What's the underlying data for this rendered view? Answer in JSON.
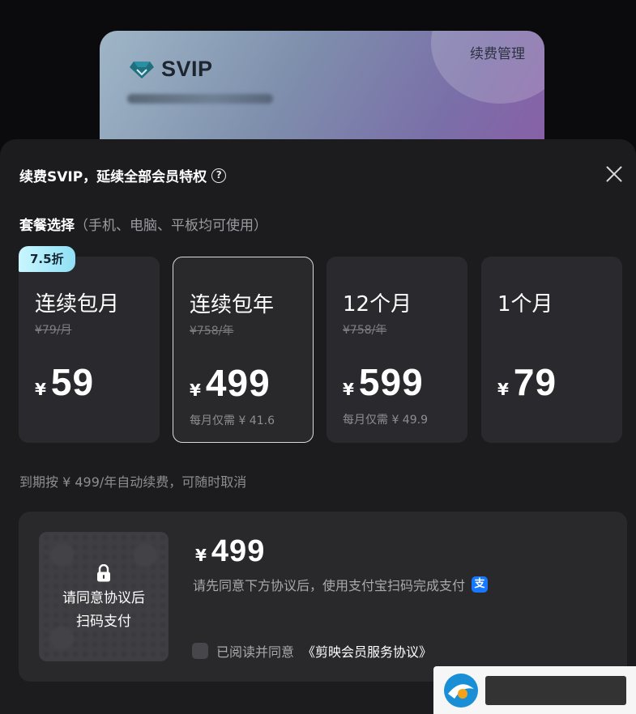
{
  "svip_card": {
    "title": "SVIP",
    "manage_label": "续费管理",
    "brand_color": "#1c2530"
  },
  "modal": {
    "title": "续费SVIP，延续全部会员特权",
    "help_icon": "?",
    "section_label": "套餐选择",
    "section_sub": "（手机、电脑、平板均可使用）",
    "plans": [
      {
        "name": "连续包月",
        "original_price": "¥79/月",
        "currency": "¥",
        "price": "59",
        "monthly": "",
        "badge": "7.5折",
        "selected": false
      },
      {
        "name": "连续包年",
        "original_price": "¥758/年",
        "currency": "¥",
        "price": "499",
        "monthly": "每月仅需 ¥ 41.6",
        "badge": "",
        "selected": true
      },
      {
        "name": "12个月",
        "original_price": "¥758/年",
        "currency": "¥",
        "price": "599",
        "monthly": "每月仅需 ¥ 49.9",
        "badge": "",
        "selected": false
      },
      {
        "name": "1个月",
        "original_price": "",
        "currency": "¥",
        "price": "79",
        "monthly": "",
        "badge": "",
        "selected": false
      }
    ],
    "renew_note": "到期按 ¥ 499/年自动续费，可随时取消",
    "payment": {
      "qr_text_line1": "请同意协议后",
      "qr_text_line2": "扫码支付",
      "currency": "¥",
      "amount": "499",
      "instruction": "请先同意下方协议后，使用支付宝扫码完成支付",
      "alipay_glyph": "支",
      "agree_text": "已阅读并同意",
      "agreement_link": "《剪映会员服务协议》",
      "agreed": false
    }
  },
  "colors": {
    "modal_bg": "#1c1c1f",
    "card_bg": "#2a2a2e",
    "badge_bg": "#a8ecfa",
    "alipay": "#1677ff"
  },
  "icons": [
    "diamond-icon",
    "help-icon",
    "close-icon",
    "lock-icon",
    "alipay-icon"
  ]
}
